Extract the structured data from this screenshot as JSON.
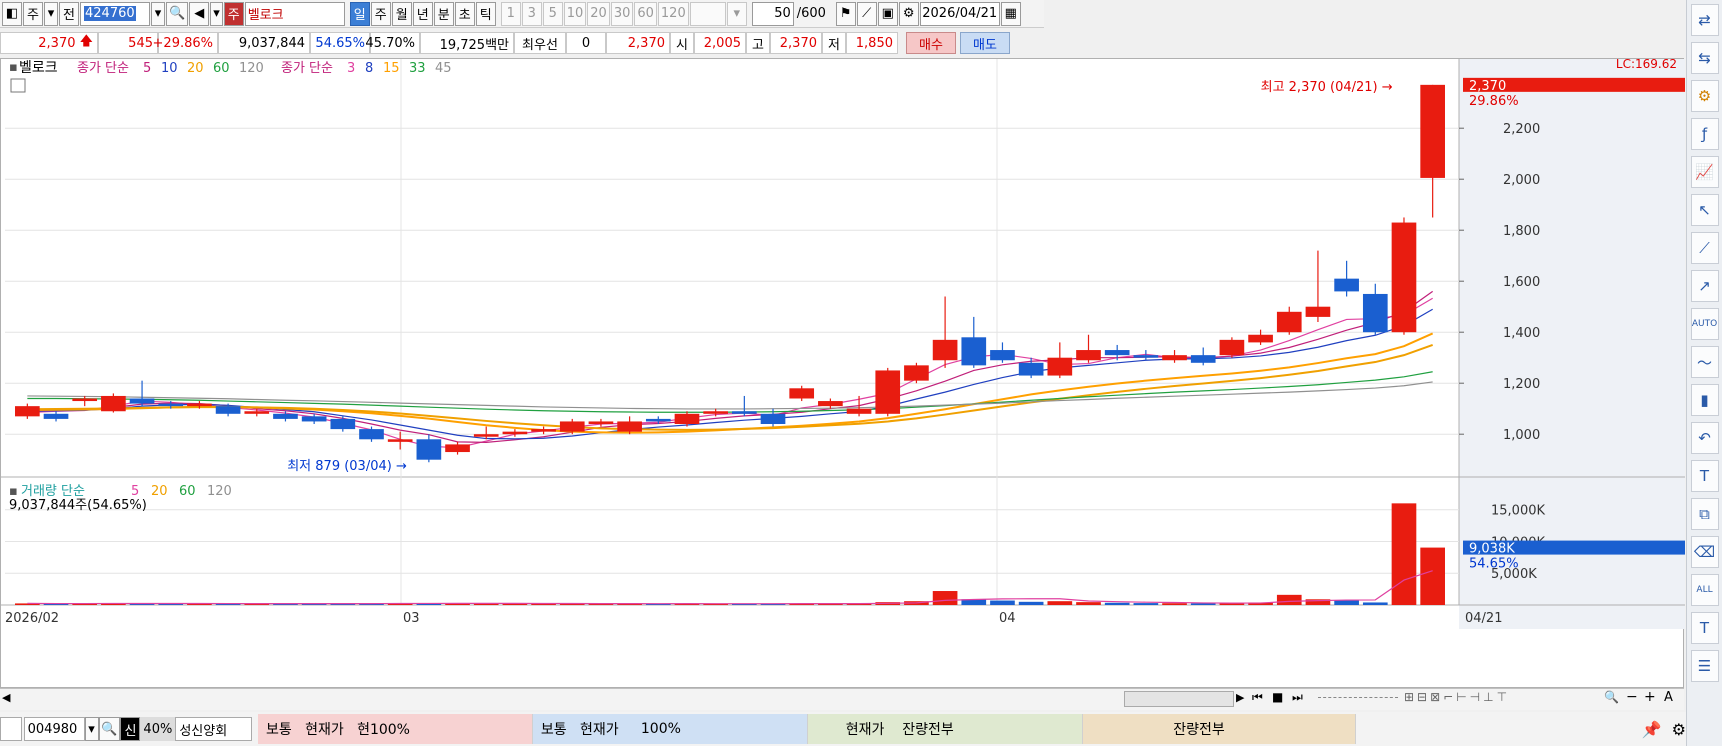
{
  "toolbar": {
    "market_btn": "주",
    "jeon_btn": "전",
    "code": "424760",
    "type_badge": "주",
    "stock_name": "벨로크",
    "periods": [
      "일",
      "주",
      "월",
      "년",
      "분",
      "초",
      "틱"
    ],
    "active_period": "일",
    "intervals": [
      "1",
      "3",
      "5",
      "10",
      "20",
      "30",
      "60",
      "120"
    ],
    "count": "50",
    "count_total": "/600",
    "date": "2026/04/21"
  },
  "quote": {
    "price": "2,370",
    "change": "545",
    "change_pct": "+29.86%",
    "volume": "9,037,844",
    "vol_ratio": "54.65%",
    "rate2": "45.70%",
    "amount": "19,725백만",
    "pref_label": "최우선",
    "pref_val": "0",
    "price2": "2,370",
    "open_label": "시",
    "open": "2,005",
    "high_label": "고",
    "high": "2,370",
    "low_label": "저",
    "low": "1,850",
    "buy": "매수",
    "sell": "매도"
  },
  "legend": {
    "title": "벨로크",
    "ma1_label": "종가 단순",
    "ma1_periods": [
      "5",
      "10",
      "20",
      "60",
      "120"
    ],
    "ma2_label": "종가 단순",
    "ma2_periods": [
      "3",
      "8",
      "15",
      "33",
      "45"
    ],
    "vol_label": "거래량 단순",
    "vol_periods": [
      "5",
      "20",
      "60",
      "120"
    ],
    "vol_info": "9,037,844주(54.65%)"
  },
  "annotations": {
    "high": "최고 2,370 (04/21)",
    "low": "최저 879 (03/04)",
    "lc": "LC:169.62",
    "last_price": "2,370",
    "last_pct": "29.86%",
    "last_vol": "9,038K",
    "last_vol_pct": "54.65%"
  },
  "chart_data": {
    "type": "candlestick",
    "y_ticks": [
      1000,
      1200,
      1400,
      1600,
      1800,
      2000,
      2200
    ],
    "ylim": [
      840,
      2440
    ],
    "vol_ticks": [
      "5,000K",
      "10,000K",
      "15,000K"
    ],
    "vol_ylim": [
      0,
      17000
    ],
    "x_labels": [
      "2026/02",
      "03",
      "04",
      "04/21"
    ],
    "candles": [
      [
        1070,
        1110,
        1060,
        1120
      ],
      [
        1080,
        1060,
        1050,
        1090
      ],
      [
        1130,
        1140,
        1110,
        1150
      ],
      [
        1090,
        1150,
        1085,
        1160
      ],
      [
        1140,
        1120,
        1110,
        1210
      ],
      [
        1120,
        1110,
        1100,
        1130
      ],
      [
        1110,
        1120,
        1100,
        1130
      ],
      [
        1110,
        1080,
        1070,
        1120
      ],
      [
        1080,
        1090,
        1070,
        1100
      ],
      [
        1080,
        1060,
        1050,
        1090
      ],
      [
        1070,
        1050,
        1040,
        1080
      ],
      [
        1060,
        1020,
        1010,
        1070
      ],
      [
        1020,
        980,
        970,
        1030
      ],
      [
        970,
        980,
        940,
        1010
      ],
      [
        980,
        900,
        890,
        1000
      ],
      [
        930,
        960,
        920,
        970
      ],
      [
        990,
        1000,
        980,
        1030
      ],
      [
        1000,
        1010,
        990,
        1020
      ],
      [
        1010,
        1020,
        1000,
        1030
      ],
      [
        1010,
        1050,
        1000,
        1060
      ],
      [
        1040,
        1050,
        1030,
        1060
      ],
      [
        1010,
        1050,
        1000,
        1070
      ],
      [
        1060,
        1050,
        1040,
        1070
      ],
      [
        1040,
        1080,
        1030,
        1090
      ],
      [
        1080,
        1090,
        1070,
        1100
      ],
      [
        1090,
        1080,
        1070,
        1150
      ],
      [
        1080,
        1040,
        1030,
        1100
      ],
      [
        1140,
        1180,
        1130,
        1190
      ],
      [
        1110,
        1130,
        1100,
        1140
      ],
      [
        1080,
        1100,
        1070,
        1150
      ],
      [
        1080,
        1250,
        1070,
        1260
      ],
      [
        1210,
        1270,
        1200,
        1280
      ],
      [
        1290,
        1370,
        1260,
        1540
      ],
      [
        1380,
        1270,
        1260,
        1460
      ],
      [
        1330,
        1290,
        1280,
        1360
      ],
      [
        1280,
        1230,
        1220,
        1300
      ],
      [
        1230,
        1300,
        1220,
        1360
      ],
      [
        1290,
        1330,
        1280,
        1390
      ],
      [
        1330,
        1310,
        1290,
        1350
      ],
      [
        1310,
        1300,
        1290,
        1330
      ],
      [
        1290,
        1310,
        1280,
        1330
      ],
      [
        1310,
        1280,
        1270,
        1340
      ],
      [
        1310,
        1370,
        1300,
        1380
      ],
      [
        1360,
        1390,
        1350,
        1410
      ],
      [
        1400,
        1480,
        1390,
        1500
      ],
      [
        1460,
        1500,
        1440,
        1720
      ],
      [
        1610,
        1560,
        1540,
        1680
      ],
      [
        1550,
        1400,
        1390,
        1590
      ],
      [
        1400,
        1830,
        1390,
        1850
      ],
      [
        2005,
        2370,
        1850,
        2370
      ]
    ],
    "volumes": [
      250,
      200,
      220,
      300,
      210,
      230,
      210,
      200,
      220,
      250,
      230,
      210,
      200,
      300,
      280,
      260,
      240,
      220,
      210,
      230,
      200,
      210,
      200,
      220,
      210,
      200,
      220,
      230,
      210,
      200,
      450,
      600,
      2200,
      900,
      700,
      500,
      600,
      450,
      350,
      300,
      280,
      260,
      300,
      400,
      1600,
      900,
      700,
      400,
      16000,
      9038
    ],
    "ma_lines": [
      {
        "name": "3",
        "color": "#e040a0",
        "values": [
          1085,
          1090,
          1093,
          1110,
          1130,
          1125,
          1115,
          1105,
          1095,
          1083,
          1067,
          1043,
          1017,
          980,
          953,
          947,
          973,
          1000,
          1013,
          1027,
          1040,
          1043,
          1047,
          1063,
          1077,
          1083,
          1073,
          1103,
          1117,
          1137,
          1160,
          1217,
          1273,
          1303,
          1313,
          1297,
          1273,
          1277,
          1300,
          1313,
          1300,
          1297,
          1307,
          1330,
          1367,
          1410,
          1450,
          1453,
          1467,
          1533
        ]
      },
      {
        "name": "5",
        "color": "#c0207a",
        "values": [
          1090,
          1092,
          1095,
          1105,
          1118,
          1122,
          1120,
          1112,
          1100,
          1092,
          1080,
          1062,
          1040,
          1016,
          998,
          970,
          968,
          978,
          990,
          1008,
          1027,
          1037,
          1042,
          1050,
          1062,
          1072,
          1078,
          1086,
          1100,
          1112,
          1138,
          1170,
          1208,
          1250,
          1272,
          1286,
          1292,
          1300,
          1300,
          1302,
          1304,
          1300,
          1306,
          1318,
          1340,
          1372,
          1408,
          1438,
          1480,
          1560
        ]
      },
      {
        "name": "8",
        "color": "#2040c0",
        "values": [
          1090,
          1092,
          1094,
          1100,
          1110,
          1115,
          1117,
          1113,
          1105,
          1097,
          1088,
          1072,
          1056,
          1036,
          1016,
          996,
          983,
          982,
          984,
          993,
          1006,
          1018,
          1028,
          1036,
          1046,
          1055,
          1062,
          1070,
          1080,
          1089,
          1110,
          1138,
          1165,
          1195,
          1222,
          1245,
          1260,
          1270,
          1280,
          1290,
          1295,
          1296,
          1299,
          1307,
          1321,
          1341,
          1367,
          1388,
          1425,
          1490
        ]
      },
      {
        "name": "15",
        "color": "#ffa000",
        "values": [
          1095,
          1096,
          1097,
          1099,
          1102,
          1105,
          1107,
          1107,
          1105,
          1101,
          1097,
          1090,
          1082,
          1072,
          1061,
          1048,
          1035,
          1025,
          1016,
          1010,
          1007,
          1006,
          1007,
          1010,
          1015,
          1021,
          1027,
          1033,
          1041,
          1050,
          1063,
          1080,
          1098,
          1118,
          1137,
          1156,
          1172,
          1186,
          1199,
          1210,
          1220,
          1229,
          1238,
          1249,
          1262,
          1279,
          1298,
          1314,
          1345,
          1395
        ]
      },
      {
        "name": "20",
        "color": "#f0a000",
        "values": [
          1098,
          1099,
          1100,
          1101,
          1103,
          1105,
          1106,
          1106,
          1105,
          1103,
          1100,
          1095,
          1089,
          1081,
          1072,
          1062,
          1052,
          1043,
          1035,
          1028,
          1023,
          1020,
          1018,
          1017,
          1018,
          1021,
          1024,
          1029,
          1035,
          1041,
          1050,
          1062,
          1077,
          1093,
          1109,
          1125,
          1139,
          1153,
          1166,
          1178,
          1189,
          1199,
          1209,
          1220,
          1233,
          1248,
          1266,
          1283,
          1310,
          1350
        ]
      },
      {
        "name": "33",
        "color": "#20a040",
        "values": [
          1140,
          1140,
          1139,
          1138,
          1137,
          1135,
          1133,
          1130,
          1127,
          1124,
          1121,
          1118,
          1114,
          1110,
          1106,
          1102,
          1098,
          1095,
          1092,
          1090,
          1088,
          1087,
          1086,
          1086,
          1086,
          1087,
          1088,
          1090,
          1093,
          1096,
          1100,
          1106,
          1112,
          1119,
          1126,
          1133,
          1140,
          1147,
          1153,
          1159,
          1165,
          1170,
          1175,
          1181,
          1187,
          1194,
          1203,
          1212,
          1225,
          1245
        ]
      },
      {
        "name": "45",
        "color": "#909090",
        "values": [
          1150,
          1149,
          1148,
          1147,
          1145,
          1143,
          1141,
          1139,
          1136,
          1133,
          1131,
          1128,
          1125,
          1122,
          1119,
          1116,
          1113,
          1110,
          1107,
          1105,
          1103,
          1101,
          1100,
          1099,
          1099,
          1099,
          1100,
          1101,
          1102,
          1104,
          1107,
          1110,
          1114,
          1118,
          1122,
          1127,
          1132,
          1136,
          1141,
          1145,
          1149,
          1153,
          1157,
          1161,
          1165,
          1170,
          1175,
          1181,
          1190,
          1205
        ]
      }
    ]
  },
  "bottom": {
    "code": "004980",
    "badge": "신",
    "pct": "40%",
    "name": "성신양회",
    "panel1_type": "보통",
    "panel1_label": "현재가",
    "panel1_val": "현100%",
    "panel2_type": "보통",
    "panel2_label": "현재가",
    "panel2_val": "100%",
    "panel3_label": "현재가",
    "panel3_val": "잔량전부",
    "panel4_val": "잔량전부"
  },
  "colors": {
    "up": "#e81c10",
    "down": "#1a5fd0",
    "grid": "#e4e4e4"
  }
}
